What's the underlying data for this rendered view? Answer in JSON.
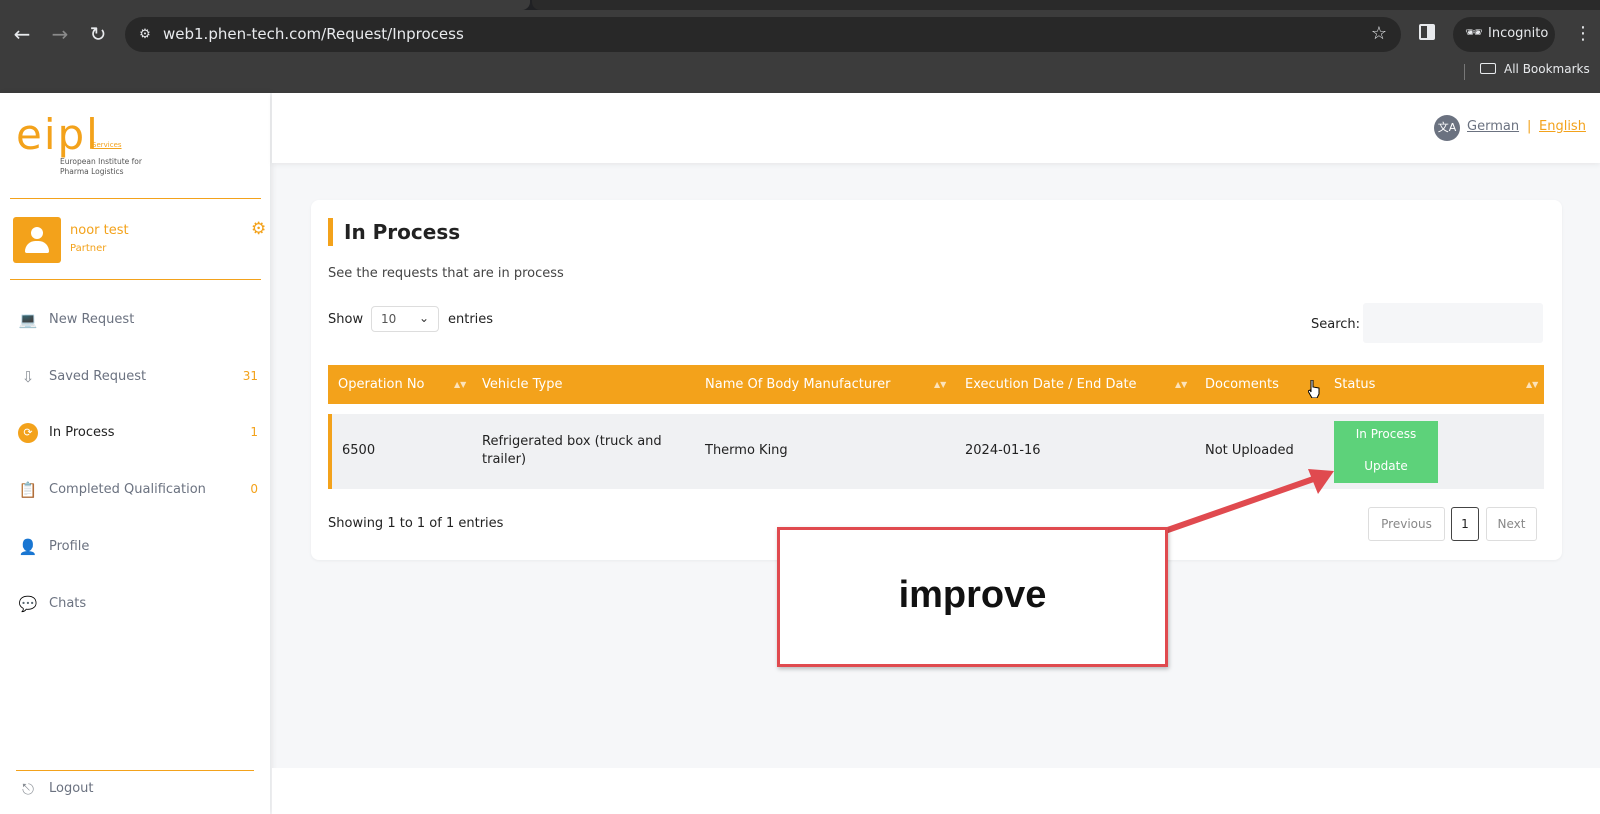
{
  "browser": {
    "url": "web1.phen-tech.com/Request/Inprocess",
    "incognito_label": "Incognito",
    "bookmarks_label": "All Bookmarks"
  },
  "logo": {
    "mark": "eipl",
    "services": "Services",
    "line1": "European Institute for",
    "line2": "Pharma Logistics"
  },
  "user": {
    "name": "noor test",
    "role": "Partner"
  },
  "sidebar": {
    "items": [
      {
        "label": "New Request",
        "count": ""
      },
      {
        "label": "Saved Request",
        "count": "31"
      },
      {
        "label": "In Process",
        "count": "1"
      },
      {
        "label": "Completed Qualification",
        "count": "0"
      },
      {
        "label": "Profile",
        "count": ""
      },
      {
        "label": "Chats",
        "count": ""
      }
    ],
    "logout": "Logout"
  },
  "lang": {
    "german": "German",
    "sep": "|",
    "english": "English"
  },
  "page": {
    "title": "In Process",
    "subtitle": "See the requests that are in process",
    "show_label": "Show",
    "entries_value": "10",
    "entries_label": "entries",
    "search_label": "Search:"
  },
  "table": {
    "headers": [
      "Operation No",
      "Vehicle Type",
      "Name Of Body Manufacturer",
      "Execution Date / End Date",
      "Docoments",
      "Status"
    ],
    "rows": [
      {
        "operation_no": "6500",
        "vehicle_type_line1": "Refrigerated box (truck and",
        "vehicle_type_line2": "trailer)",
        "manufacturer": "Thermo King",
        "date": "2024-01-16",
        "documents": "Not Uploaded",
        "status": "In Process",
        "action": "Update"
      }
    ]
  },
  "footer": {
    "showing": "Showing 1 to 1 of 1 entries",
    "previous": "Previous",
    "page": "1",
    "next": "Next"
  },
  "annotation": {
    "text": "improve"
  },
  "colors": {
    "accent": "#f3a21b",
    "status_green": "#5dd27a",
    "annotation_red": "#e04a4f"
  }
}
